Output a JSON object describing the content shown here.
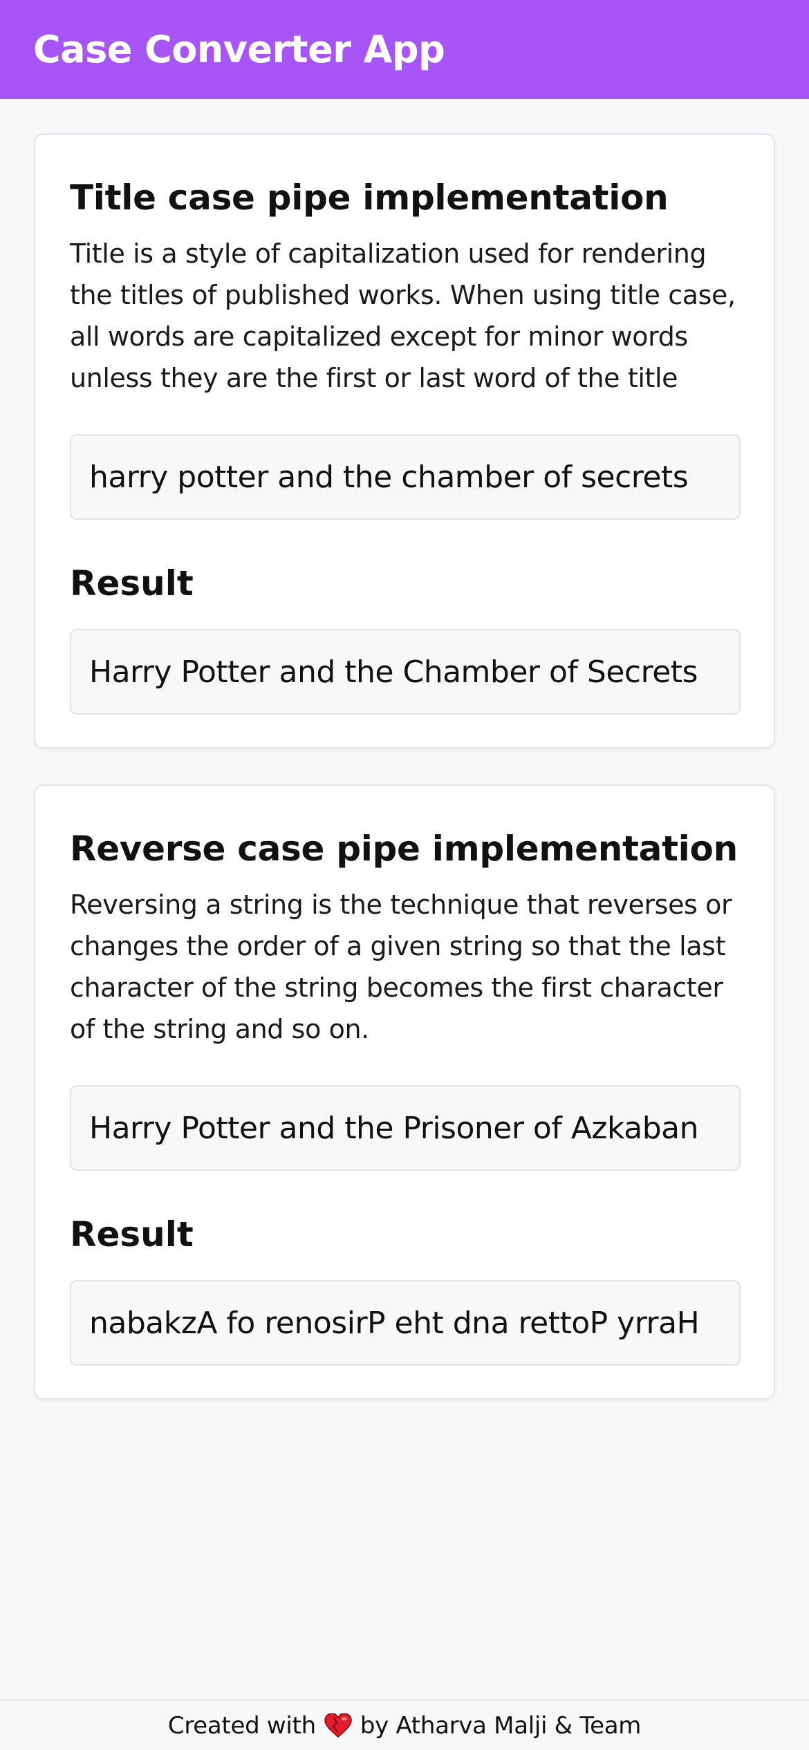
{
  "header": {
    "title": "Case Converter App",
    "color": "#a855f7"
  },
  "cards": [
    {
      "title": "Title case pipe implementation",
      "description": "Title is a style of capitalization used for rendering the titles of published works. When using title case, all words are capitalized except for minor words unless they are the first or last word of the title",
      "input_value": "harry potter and the chamber of secrets",
      "result_label": "Result",
      "result_value": "Harry Potter and the Chamber of Secrets"
    },
    {
      "title": "Reverse case pipe implementation",
      "description": "Reversing a string is the technique that reverses or changes the order of a given string so that the last character of the string becomes the first character of the string and so on.",
      "input_value": "Harry Potter and the Prisoner of Azkaban",
      "result_label": "Result",
      "result_value": "nabakzA fo renosirP eht dna rettoP yrraH"
    }
  ],
  "footer": {
    "prefix": "Created with",
    "icon": "heart-icon",
    "suffix": "by Atharva Malji & Team"
  }
}
